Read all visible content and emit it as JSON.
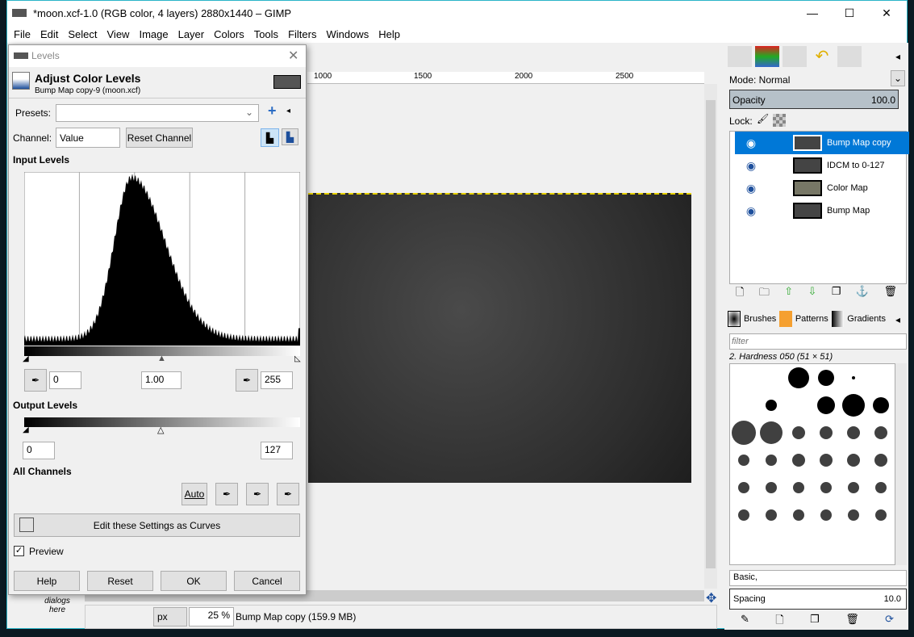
{
  "window": {
    "title": "*moon.xcf-1.0 (RGB color, 4 layers) 2880x1440 – GIMP",
    "minimize": "—",
    "maximize": "☐",
    "close": "✕"
  },
  "menu": [
    "File",
    "Edit",
    "Select",
    "View",
    "Image",
    "Layer",
    "Colors",
    "Tools",
    "Filters",
    "Windows",
    "Help"
  ],
  "ruler": [
    "1000",
    "1500",
    "2000",
    "2500"
  ],
  "statusbar": {
    "unit": "px",
    "zoom": "25 %",
    "info": "Bump Map copy (159.9 MB)",
    "dialogs_hint_1": "dialogs",
    "dialogs_hint_2": "here"
  },
  "levels": {
    "title": "Levels",
    "heading": "Adjust Color Levels",
    "subheading": "Bump Map copy-9 (moon.xcf)",
    "presets_label": "Presets:",
    "presets_value": "",
    "channel_label": "Channel:",
    "channel_value": "Value",
    "reset_channel": "Reset Channel",
    "input_levels": "Input Levels",
    "input_low": "0",
    "input_gamma": "1.00",
    "input_high": "255",
    "output_levels": "Output Levels",
    "output_low": "0",
    "output_high": "127",
    "all_channels": "All Channels",
    "auto": "Auto",
    "edit_curves": "Edit these Settings as Curves",
    "preview_label": "Preview",
    "preview_checked": true,
    "buttons": [
      "Help",
      "Reset",
      "OK",
      "Cancel"
    ]
  },
  "layers_panel": {
    "mode": "Mode: Normal",
    "opacity_label": "Opacity",
    "opacity_value": "100.0",
    "lock_label": "Lock:",
    "layers": [
      {
        "name": "Bump Map copy",
        "selected": true
      },
      {
        "name": "IDCM to 0-127"
      },
      {
        "name": "Color Map"
      },
      {
        "name": "Bump Map"
      }
    ]
  },
  "brushes_panel": {
    "tabs": [
      "Brushes",
      "Patterns",
      "Gradients"
    ],
    "filter_placeholder": "filter",
    "brush_name": "2. Hardness 050 (51 × 51)",
    "preset": "Basic,",
    "spacing_label": "Spacing",
    "spacing_value": "10.0"
  },
  "colors": {
    "accent": "#0078d7",
    "selected_layer": "#0078d7",
    "opacity_bar": "#b6c1c9"
  }
}
